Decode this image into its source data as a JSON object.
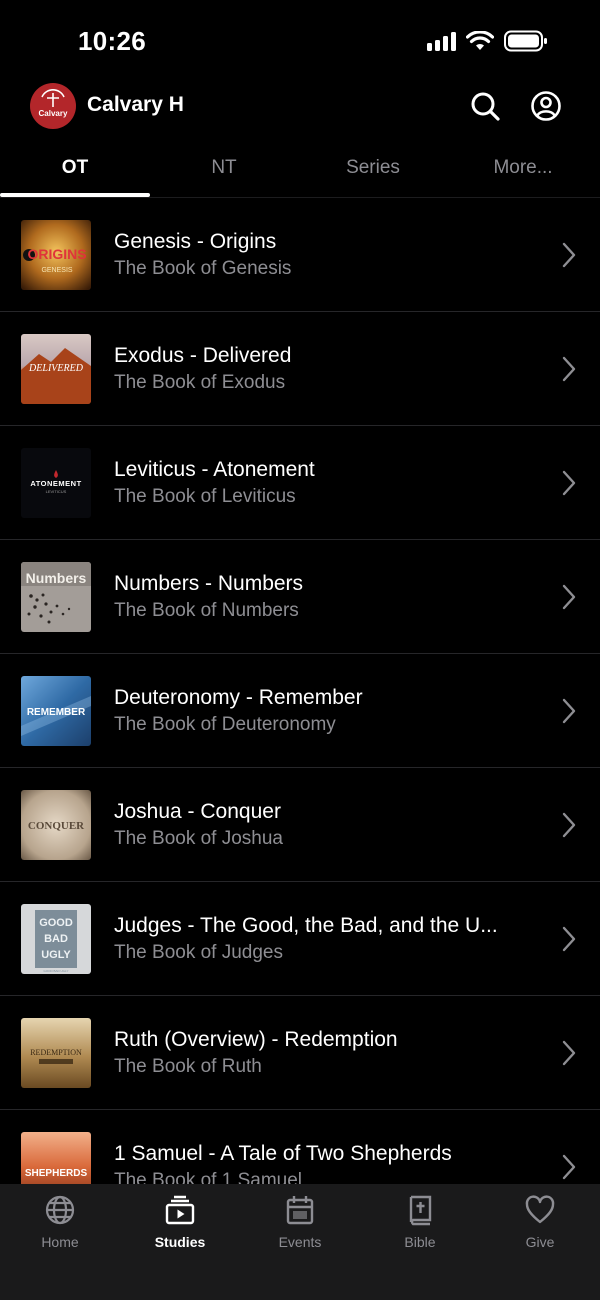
{
  "status": {
    "time": "10:26"
  },
  "header": {
    "org_name": "Calvary H",
    "logo_text": "Calvary"
  },
  "tabs": [
    {
      "label": "OT",
      "active": true
    },
    {
      "label": "NT",
      "active": false
    },
    {
      "label": "Series",
      "active": false
    },
    {
      "label": "More...",
      "active": false
    }
  ],
  "studies": [
    {
      "title": "Genesis - Origins",
      "subtitle": "The Book of Genesis",
      "art_text": "ORIGINS",
      "art_sub": "GENESIS"
    },
    {
      "title": "Exodus - Delivered",
      "subtitle": "The Book of Exodus",
      "art_text": "DELIVERED",
      "art_sub": ""
    },
    {
      "title": "Leviticus - Atonement",
      "subtitle": "The Book of Leviticus",
      "art_text": "ATONEMENT",
      "art_sub": "LEVITICUS"
    },
    {
      "title": "Numbers - Numbers",
      "subtitle": "The Book of Numbers",
      "art_text": "Numbers",
      "art_sub": ""
    },
    {
      "title": "Deuteronomy - Remember",
      "subtitle": "The Book of Deuteronomy",
      "art_text": "REMEMBER",
      "art_sub": ""
    },
    {
      "title": "Joshua - Conquer",
      "subtitle": "The Book of Joshua",
      "art_text": "CONQUER",
      "art_sub": ""
    },
    {
      "title": "Judges - The Good, the Bad, and the U...",
      "subtitle": "The Book of Judges",
      "art_text": "GOOD BAD UGLY",
      "art_sub": ""
    },
    {
      "title": "Ruth (Overview) - Redemption",
      "subtitle": "The Book of Ruth",
      "art_text": "REDEMPTION",
      "art_sub": ""
    },
    {
      "title": "1 Samuel - A Tale of Two Shepherds",
      "subtitle": "The Book of 1 Samuel",
      "art_text": "SHEPHERDS",
      "art_sub": ""
    }
  ],
  "bottom_nav": [
    {
      "label": "Home",
      "icon": "globe-icon",
      "active": false
    },
    {
      "label": "Studies",
      "icon": "studies-icon",
      "active": true
    },
    {
      "label": "Events",
      "icon": "calendar-icon",
      "active": false
    },
    {
      "label": "Bible",
      "icon": "bible-icon",
      "active": false
    },
    {
      "label": "Give",
      "icon": "heart-icon",
      "active": false
    }
  ],
  "colors": {
    "background": "#000000",
    "accent": "#b3262a",
    "inactive": "#8d8d93",
    "nav_background": "#1a1a1b"
  }
}
